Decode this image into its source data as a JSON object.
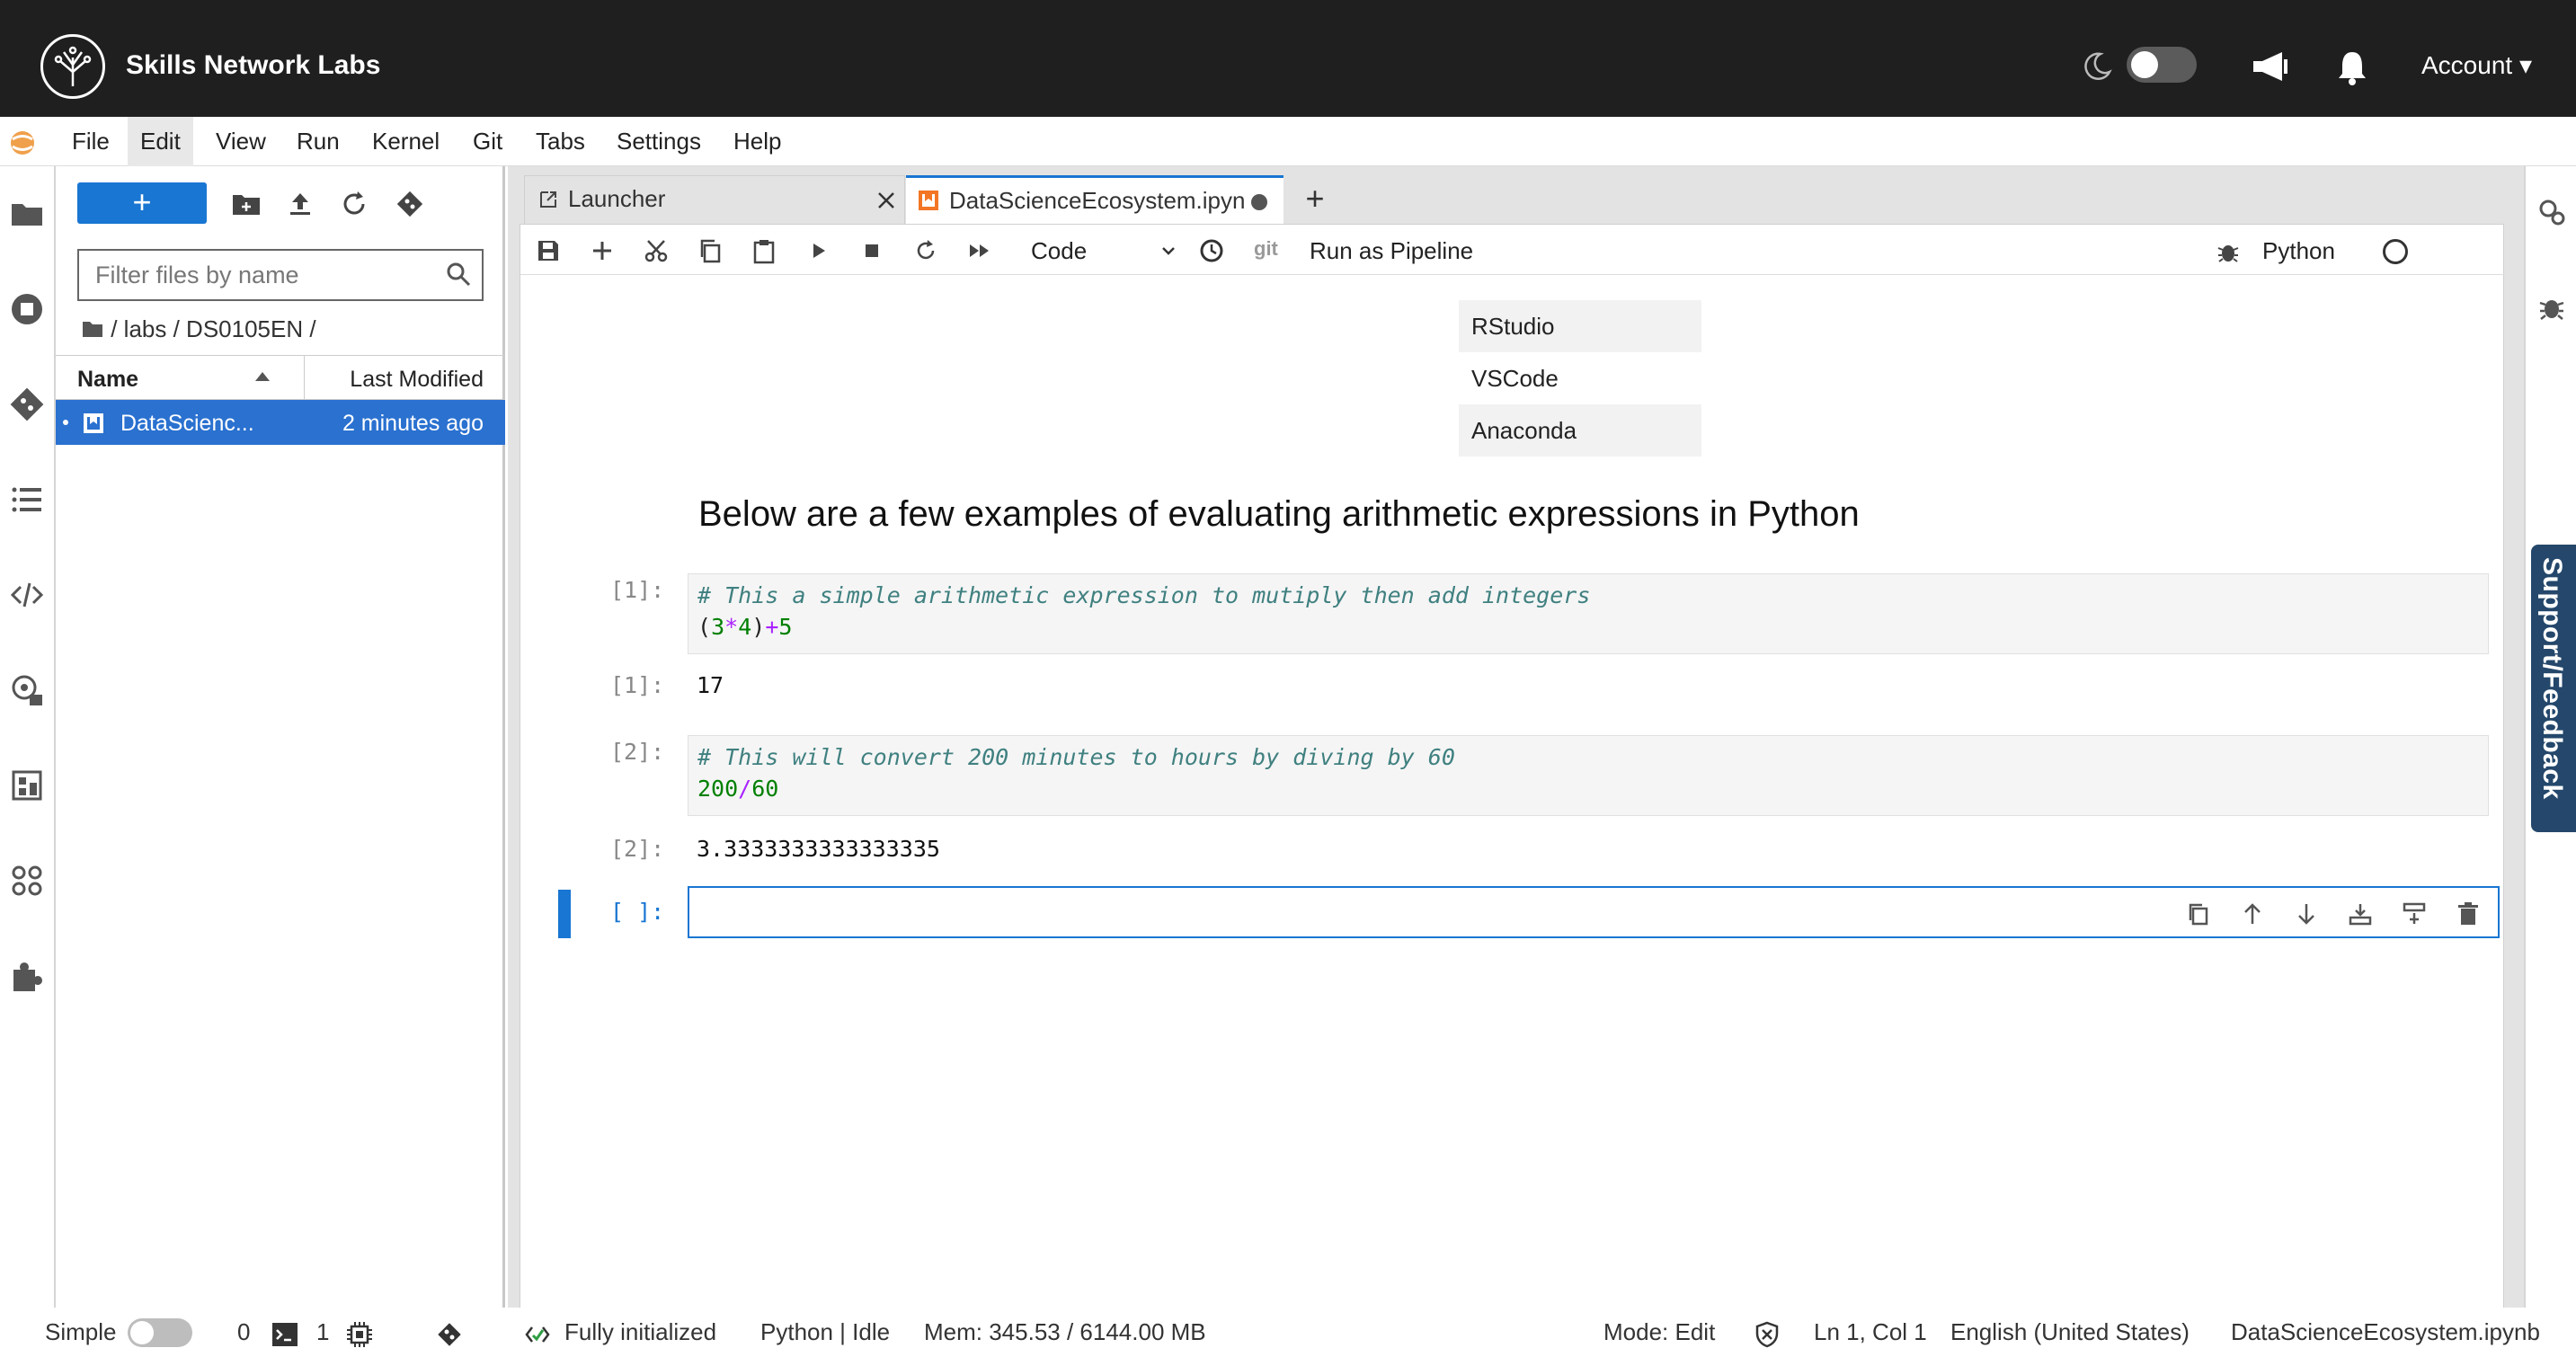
{
  "topbar": {
    "brand": "Skills Network Labs",
    "account": "Account ▾"
  },
  "menu": [
    "File",
    "Edit",
    "View",
    "Run",
    "Kernel",
    "Git",
    "Tabs",
    "Settings",
    "Help"
  ],
  "filebrowser": {
    "new_label": "+",
    "filter_placeholder": "Filter files by name",
    "breadcrumb": "/ labs / DS0105EN /",
    "col_name": "Name",
    "col_modified": "Last Modified",
    "file": {
      "name": "DataScienc...",
      "modified": "2 minutes ago"
    }
  },
  "tabs": {
    "launcher": "Launcher",
    "notebook": "DataScienceEcosystem.ipyn",
    "add": "+"
  },
  "toolbar": {
    "cell_type": "Code",
    "git": "git",
    "pipeline": "Run as Pipeline",
    "kernel": "Python"
  },
  "notebook": {
    "tools": [
      "RStudio",
      "VSCode",
      "Anaconda"
    ],
    "heading": "Below are a few examples of evaluating arithmetic expressions in Python",
    "cell1": {
      "prompt": "[1]:",
      "comment": "# This a simple arithmetic expression to mutiply then add integers",
      "code_parts": [
        "(",
        "3",
        "*",
        "4",
        ")",
        "+",
        "5"
      ],
      "out_prompt": "[1]:",
      "output": "17"
    },
    "cell2": {
      "prompt": "[2]:",
      "comment": "# This will convert 200 minutes to hours by diving by 60",
      "code_parts": [
        "200",
        "/",
        "60"
      ],
      "out_prompt": "[2]:",
      "output": "3.3333333333333335"
    },
    "empty_prompt": "[ ]:"
  },
  "support": "Support/Feedback",
  "status": {
    "simple": "Simple",
    "count0": "0",
    "count1": "1",
    "init": "Fully initialized",
    "kernel": "Python | Idle",
    "mem": "Mem: 345.53 / 6144.00 MB",
    "mode": "Mode: Edit",
    "position": "Ln 1, Col 1",
    "language": "English (United States)",
    "file": "DataScienceEcosystem.ipynb"
  }
}
